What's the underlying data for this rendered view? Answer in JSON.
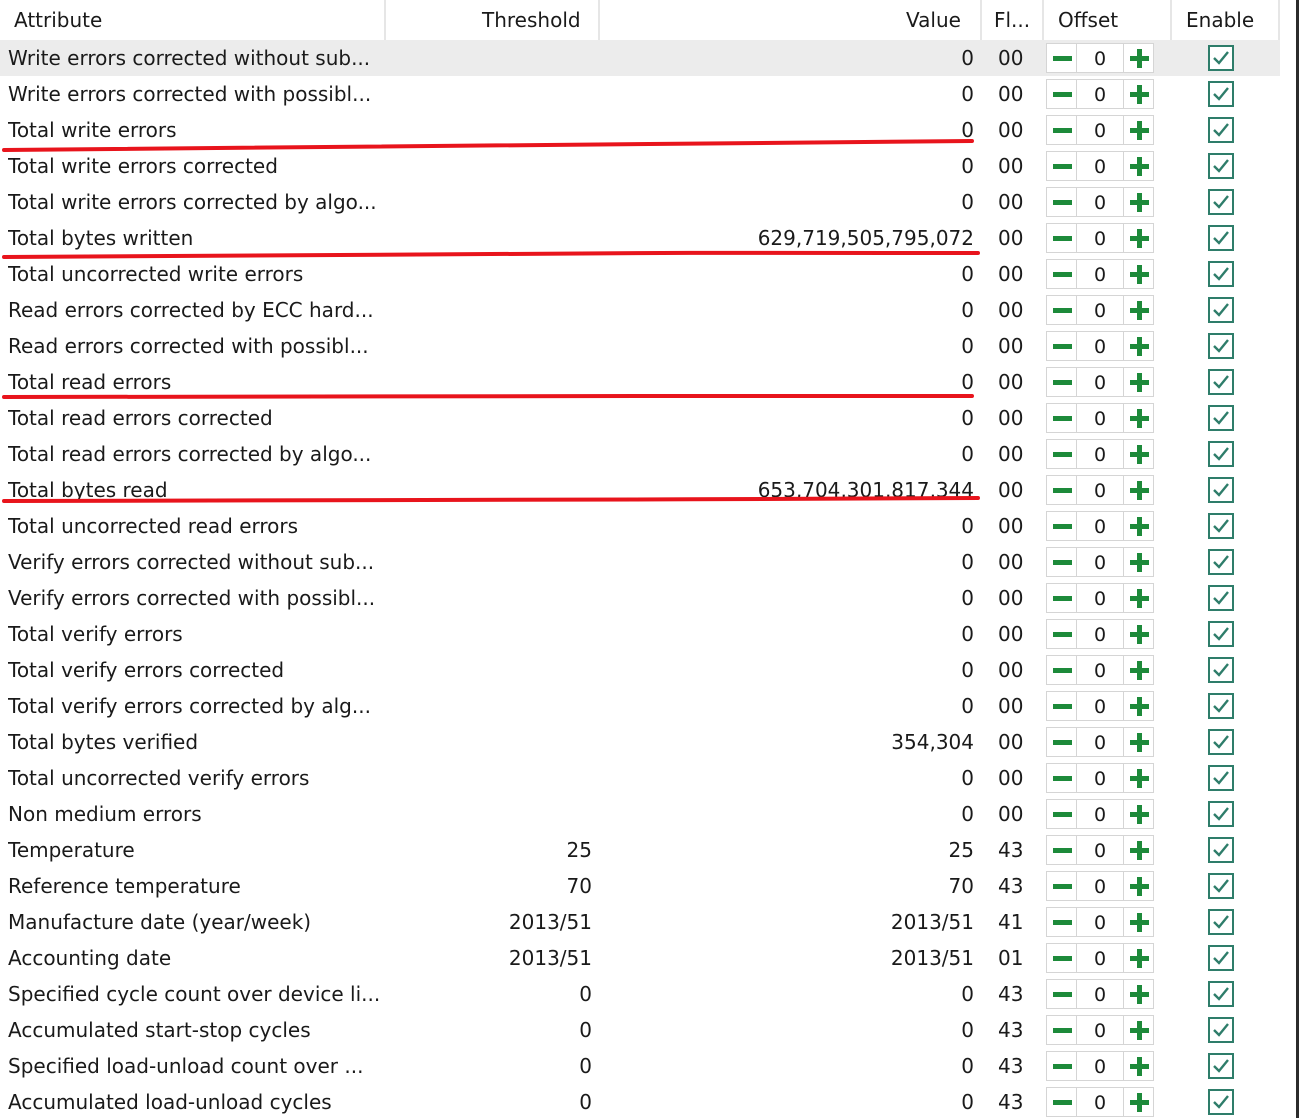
{
  "columns": {
    "attribute": "Attribute",
    "threshold": "Threshold",
    "value": "Value",
    "flags": "Fl...",
    "offset": "Offset",
    "enable": "Enable"
  },
  "icons": {
    "minus": "minus-icon",
    "plus": "plus-icon",
    "check": "checkmark-icon"
  },
  "colors": {
    "annotation": "#e8141c",
    "stepper_icon": "#1d8a3a",
    "checkbox": "#2e7d6a"
  },
  "rows": [
    {
      "attribute": "Write errors corrected without sub...",
      "threshold": "",
      "value": "0",
      "flags": "00",
      "offset": "0",
      "enabled": true
    },
    {
      "attribute": "Write errors corrected with possibl...",
      "threshold": "",
      "value": "0",
      "flags": "00",
      "offset": "0",
      "enabled": true
    },
    {
      "attribute": "Total write errors",
      "threshold": "",
      "value": "0",
      "flags": "00",
      "offset": "0",
      "enabled": true
    },
    {
      "attribute": "Total write errors corrected",
      "threshold": "",
      "value": "0",
      "flags": "00",
      "offset": "0",
      "enabled": true
    },
    {
      "attribute": "Total write errors corrected by algo...",
      "threshold": "",
      "value": "0",
      "flags": "00",
      "offset": "0",
      "enabled": true
    },
    {
      "attribute": "Total bytes written",
      "threshold": "",
      "value": "629,719,505,795,072",
      "flags": "00",
      "offset": "0",
      "enabled": true
    },
    {
      "attribute": "Total uncorrected write errors",
      "threshold": "",
      "value": "0",
      "flags": "00",
      "offset": "0",
      "enabled": true
    },
    {
      "attribute": "Read errors corrected by ECC hard...",
      "threshold": "",
      "value": "0",
      "flags": "00",
      "offset": "0",
      "enabled": true
    },
    {
      "attribute": "Read errors corrected with possibl...",
      "threshold": "",
      "value": "0",
      "flags": "00",
      "offset": "0",
      "enabled": true
    },
    {
      "attribute": "Total read errors",
      "threshold": "",
      "value": "0",
      "flags": "00",
      "offset": "0",
      "enabled": true
    },
    {
      "attribute": "Total read errors corrected",
      "threshold": "",
      "value": "0",
      "flags": "00",
      "offset": "0",
      "enabled": true
    },
    {
      "attribute": "Total read errors corrected by algo...",
      "threshold": "",
      "value": "0",
      "flags": "00",
      "offset": "0",
      "enabled": true
    },
    {
      "attribute": "Total bytes read",
      "threshold": "",
      "value": "653,704,301,817,344",
      "flags": "00",
      "offset": "0",
      "enabled": true
    },
    {
      "attribute": "Total uncorrected read errors",
      "threshold": "",
      "value": "0",
      "flags": "00",
      "offset": "0",
      "enabled": true
    },
    {
      "attribute": "Verify errors corrected without sub...",
      "threshold": "",
      "value": "0",
      "flags": "00",
      "offset": "0",
      "enabled": true
    },
    {
      "attribute": "Verify errors corrected with possibl...",
      "threshold": "",
      "value": "0",
      "flags": "00",
      "offset": "0",
      "enabled": true
    },
    {
      "attribute": "Total verify errors",
      "threshold": "",
      "value": "0",
      "flags": "00",
      "offset": "0",
      "enabled": true
    },
    {
      "attribute": "Total verify errors corrected",
      "threshold": "",
      "value": "0",
      "flags": "00",
      "offset": "0",
      "enabled": true
    },
    {
      "attribute": "Total verify errors corrected by alg...",
      "threshold": "",
      "value": "0",
      "flags": "00",
      "offset": "0",
      "enabled": true
    },
    {
      "attribute": "Total bytes verified",
      "threshold": "",
      "value": "354,304",
      "flags": "00",
      "offset": "0",
      "enabled": true
    },
    {
      "attribute": "Total uncorrected verify errors",
      "threshold": "",
      "value": "0",
      "flags": "00",
      "offset": "0",
      "enabled": true
    },
    {
      "attribute": "Non medium errors",
      "threshold": "",
      "value": "0",
      "flags": "00",
      "offset": "0",
      "enabled": true
    },
    {
      "attribute": "Temperature",
      "threshold": "25",
      "value": "25",
      "flags": "43",
      "offset": "0",
      "enabled": true
    },
    {
      "attribute": "Reference temperature",
      "threshold": "70",
      "value": "70",
      "flags": "43",
      "offset": "0",
      "enabled": true
    },
    {
      "attribute": "Manufacture date (year/week)",
      "threshold": "2013/51",
      "value": "2013/51",
      "flags": "41",
      "offset": "0",
      "enabled": true
    },
    {
      "attribute": "Accounting date",
      "threshold": "2013/51",
      "value": "2013/51",
      "flags": "01",
      "offset": "0",
      "enabled": true
    },
    {
      "attribute": "Specified cycle count over device li...",
      "threshold": "0",
      "value": "0",
      "flags": "43",
      "offset": "0",
      "enabled": true
    },
    {
      "attribute": "Accumulated start-stop cycles",
      "threshold": "0",
      "value": "0",
      "flags": "43",
      "offset": "0",
      "enabled": true
    },
    {
      "attribute": "Specified load-unload count over ...",
      "threshold": "0",
      "value": "0",
      "flags": "43",
      "offset": "0",
      "enabled": true
    },
    {
      "attribute": "Accumulated load-unload cycles",
      "threshold": "0",
      "value": "0",
      "flags": "43",
      "offset": "0",
      "enabled": true
    }
  ]
}
